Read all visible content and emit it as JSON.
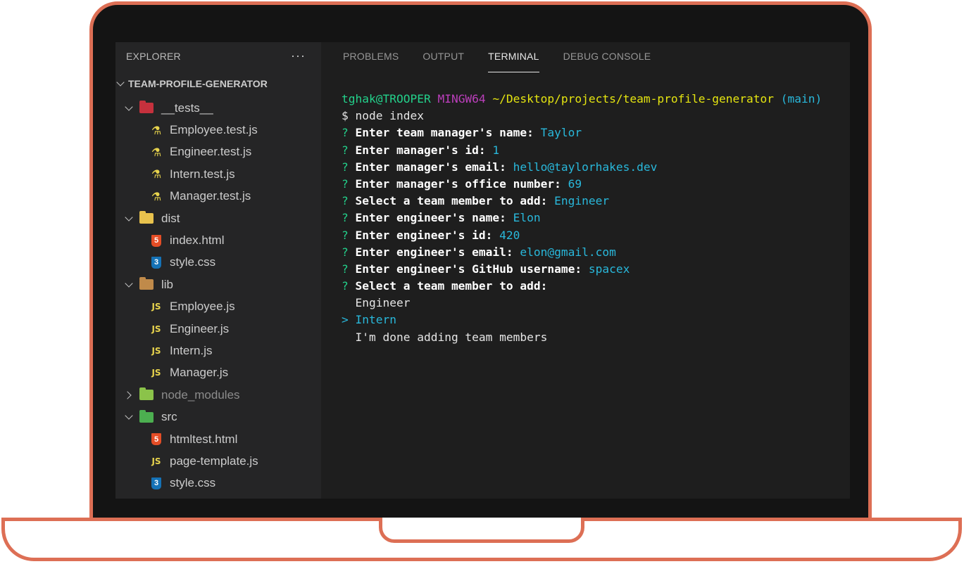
{
  "sidebar": {
    "header": "EXPLORER",
    "more": "···",
    "project": "TEAM-PROFILE-GENERATOR",
    "tree": [
      {
        "kind": "folder",
        "label": "__tests__",
        "open": true,
        "color": "#c5313d"
      },
      {
        "kind": "file",
        "label": "Employee.test.js",
        "icon": "test"
      },
      {
        "kind": "file",
        "label": "Engineer.test.js",
        "icon": "test"
      },
      {
        "kind": "file",
        "label": "Intern.test.js",
        "icon": "test"
      },
      {
        "kind": "file",
        "label": "Manager.test.js",
        "icon": "test"
      },
      {
        "kind": "folder",
        "label": "dist",
        "open": true,
        "color": "#e8c24d"
      },
      {
        "kind": "file",
        "label": "index.html",
        "icon": "html"
      },
      {
        "kind": "file",
        "label": "style.css",
        "icon": "css"
      },
      {
        "kind": "folder",
        "label": "lib",
        "open": true,
        "color": "#c08a4a"
      },
      {
        "kind": "file",
        "label": "Employee.js",
        "icon": "js"
      },
      {
        "kind": "file",
        "label": "Engineer.js",
        "icon": "js"
      },
      {
        "kind": "file",
        "label": "Intern.js",
        "icon": "js"
      },
      {
        "kind": "file",
        "label": "Manager.js",
        "icon": "js"
      },
      {
        "kind": "folder",
        "label": "node_modules",
        "open": false,
        "color": "#8bc34a",
        "dim": true
      },
      {
        "kind": "folder",
        "label": "src",
        "open": true,
        "color": "#4caf50"
      },
      {
        "kind": "file",
        "label": "htmltest.html",
        "icon": "html"
      },
      {
        "kind": "file",
        "label": "page-template.js",
        "icon": "js"
      },
      {
        "kind": "file",
        "label": "style.css",
        "icon": "css"
      }
    ]
  },
  "panel": {
    "tabs": [
      "PROBLEMS",
      "OUTPUT",
      "TERMINAL",
      "DEBUG CONSOLE"
    ],
    "active_tab": "TERMINAL"
  },
  "terminal": {
    "prompt": {
      "user": "tghak@TROOPER",
      "shell": "MINGW64",
      "path": "~/Desktop/projects/team-profile-generator",
      "branch": "(main)"
    },
    "command": "$ node index",
    "qa": [
      {
        "q": "Enter team manager's name:",
        "a": "Taylor"
      },
      {
        "q": "Enter manager's id:",
        "a": "1"
      },
      {
        "q": "Enter manager's email:",
        "a": "hello@taylorhakes.dev"
      },
      {
        "q": "Enter manager's office number:",
        "a": "69"
      },
      {
        "q": "Select a team member to add:",
        "a": "Engineer"
      },
      {
        "q": "Enter engineer's name:",
        "a": "Elon"
      },
      {
        "q": "Enter engineer's id:",
        "a": "420"
      },
      {
        "q": "Enter engineer's email:",
        "a": "elon@gmail.com"
      },
      {
        "q": "Enter engineer's GitHub username:",
        "a": "spacex"
      },
      {
        "q": "Select a team member to add:",
        "a": ""
      }
    ],
    "choices": [
      {
        "label": "Engineer",
        "selected": false
      },
      {
        "label": "Intern",
        "selected": true
      },
      {
        "label": "I'm done adding team members",
        "selected": false
      }
    ]
  }
}
